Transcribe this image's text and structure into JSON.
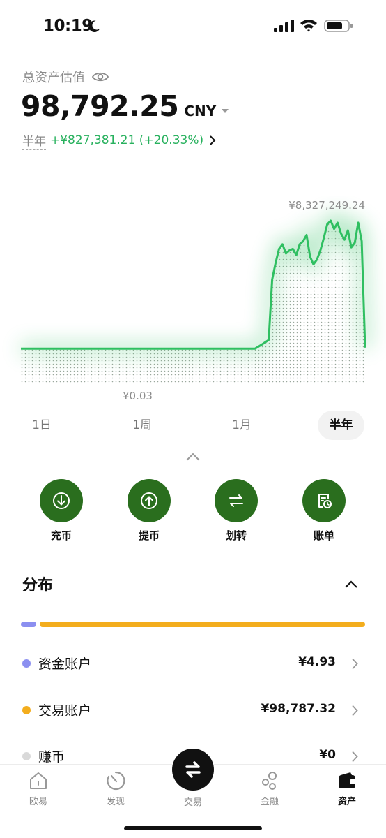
{
  "status_bar": {
    "time": "10:19"
  },
  "header": {
    "asset_label": "总资产估值",
    "asset_value": "98,792.25",
    "currency": "CNY",
    "pnl_period": "半年",
    "pnl_value": "+¥827,381.21 (+20.33%)"
  },
  "chart": {
    "high_label": "¥8,327,249.24",
    "low_label": "¥0.03",
    "line_color": "#2fbf61"
  },
  "chart_data": {
    "type": "area",
    "x": [
      0,
      5,
      10,
      15,
      20,
      25,
      30,
      35,
      40,
      45,
      50,
      55,
      60,
      65,
      68,
      70,
      72,
      73,
      74,
      75,
      76,
      77,
      78,
      79,
      80,
      81,
      82,
      83,
      84,
      85,
      86,
      87,
      88,
      89,
      90,
      91,
      92,
      93,
      94,
      95,
      96,
      97,
      98,
      99,
      100
    ],
    "y": [
      0.03,
      0.03,
      0.03,
      0.03,
      0.03,
      0.03,
      0.03,
      0.03,
      0.03,
      0.03,
      0.03,
      0.03,
      0.03,
      0.03,
      0.03,
      0.3,
      0.6,
      4.5,
      5.6,
      6.5,
      6.8,
      6.2,
      6.4,
      6.5,
      6.1,
      6.8,
      7.0,
      7.4,
      6.0,
      5.5,
      5.8,
      6.4,
      7.2,
      8.1,
      8.33,
      7.8,
      8.2,
      7.5,
      7.1,
      7.7,
      6.6,
      6.9,
      8.2,
      7.0,
      0.1
    ],
    "y_unit": "¥M",
    "max_label": "¥8,327,249.24",
    "min_label": "¥0.03",
    "grid": false
  },
  "period_tabs": [
    "1日",
    "1周",
    "1月",
    "半年"
  ],
  "active_period": "半年",
  "actions": [
    {
      "label": "充币",
      "icon": "deposit-icon"
    },
    {
      "label": "提币",
      "icon": "withdraw-icon"
    },
    {
      "label": "划转",
      "icon": "transfer-icon"
    },
    {
      "label": "账单",
      "icon": "bill-icon"
    }
  ],
  "action_color": "#2a6e1e",
  "distribution": {
    "title": "分布",
    "accounts": [
      {
        "name": "资金账户",
        "value": "¥4.93",
        "color": "#8b8ff0"
      },
      {
        "name": "交易账户",
        "value": "¥98,787.32",
        "color": "#f3ad1d"
      },
      {
        "name": "赚币",
        "value": "¥0",
        "color": "#d9d9d9"
      }
    ]
  },
  "tab_bar": {
    "items": [
      {
        "label": "欧易",
        "icon": "home-icon"
      },
      {
        "label": "发现",
        "icon": "discover-icon"
      },
      {
        "label": "交易",
        "icon": "trade-icon"
      },
      {
        "label": "金融",
        "icon": "finance-icon"
      },
      {
        "label": "资产",
        "icon": "wallet-icon"
      }
    ],
    "active": "资产"
  }
}
